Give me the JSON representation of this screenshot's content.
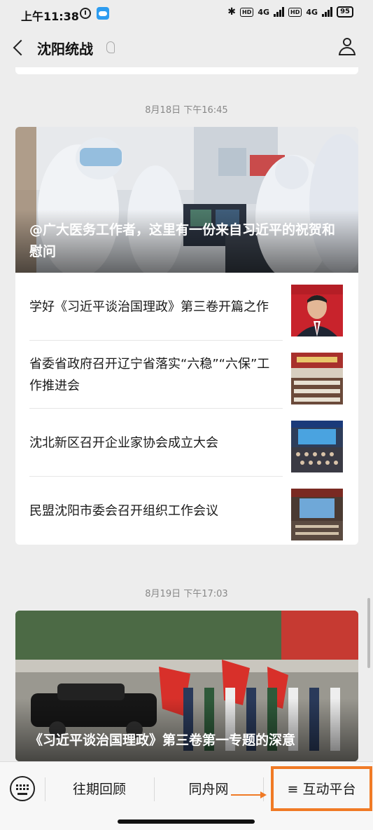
{
  "status_bar": {
    "time": "上午11:38",
    "network_left": "4G",
    "network_right": "4G",
    "hd_label": "HD",
    "battery": "95"
  },
  "navbar": {
    "title": "沈阳统战"
  },
  "feed": [
    {
      "timestamp": "8月18日 下午16:45",
      "cover_title": "@广大医务工作者，这里有一份来自习近平的祝贺和慰问",
      "items": [
        {
          "title": "学好《习近平谈治国理政》第三卷开篇之作"
        },
        {
          "title": "省委省政府召开辽宁省落实“六稳”“六保”工作推进会"
        },
        {
          "title": "沈北新区召开企业家协会成立大会"
        },
        {
          "title": "民盟沈阳市委会召开组织工作会议"
        }
      ]
    },
    {
      "timestamp": "8月19日 下午17:03",
      "cover_title": "《习近平谈治国理政》第三卷第一专题的深意"
    }
  ],
  "bottom_menu": {
    "items": [
      {
        "label": "往期回顾"
      },
      {
        "label": "同舟网"
      },
      {
        "label": "≡ 互动平台"
      }
    ],
    "highlight_color": "#f07a25"
  }
}
